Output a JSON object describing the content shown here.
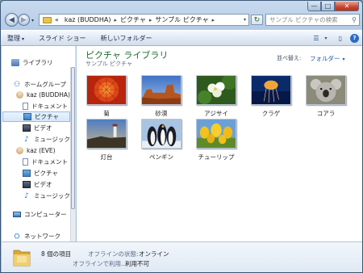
{
  "window": {
    "min_icon": "minimize-icon",
    "max_icon": "maximize-icon",
    "close_icon": "close-icon",
    "min_glyph": "—",
    "max_glyph": "□",
    "close_glyph": "✕"
  },
  "nav": {
    "back_glyph": "◀",
    "forward_glyph": "▶",
    "history_glyph": "▾",
    "address": {
      "overflow": "«",
      "crumbs": [
        "kaz (BUDDHA)",
        "ピクチャ",
        "サンプル ピクチャ"
      ],
      "separator": "▸",
      "dropdown": "▾"
    },
    "refresh_glyph": "↻",
    "search_placeholder": "サンプル ピクチャの検索",
    "search_glyph": "⚲"
  },
  "toolbar": {
    "organize": "整理",
    "slideshow": "スライド ショー",
    "new_folder": "新しいフォルダー",
    "caret": "▾",
    "views_glyph": "☰",
    "preview_glyph": "▯",
    "help_glyph": "?"
  },
  "sidebar": {
    "library": "ライブラリ",
    "homegroup": "ホームグループ",
    "user1": "kaz (BUDDHA)",
    "user1_items": [
      "ドキュメント",
      "ピクチャ",
      "ビデオ",
      "ミュージック"
    ],
    "user2": "kaz (EVE)",
    "user2_items": [
      "ドキュメント",
      "ピクチャ",
      "ビデオ",
      "ミュージック"
    ],
    "computer": "コンピューター",
    "network": "ネットワーク",
    "music_glyph": "♪",
    "group_glyph": "⚇",
    "network_glyph": "⛭"
  },
  "main": {
    "title": "ピクチャ ライブラリ",
    "subtitle": "サンプル ピクチャ",
    "sort_label": "並べ替え:",
    "sort_value": "フォルダー",
    "sort_caret": "▾",
    "items": [
      {
        "name": "菊",
        "icon": "chrysanthemum-image"
      },
      {
        "name": "砂漠",
        "icon": "desert-image"
      },
      {
        "name": "アジサイ",
        "icon": "hydrangea-image"
      },
      {
        "name": "クラゲ",
        "icon": "jellyfish-image"
      },
      {
        "name": "コアラ",
        "icon": "koala-image"
      },
      {
        "name": "灯台",
        "icon": "lighthouse-image"
      },
      {
        "name": "ペンギン",
        "icon": "penguins-image"
      },
      {
        "name": "チューリップ",
        "icon": "tulips-image"
      }
    ]
  },
  "status": {
    "count": "8 個の項目",
    "offline_label": "オフラインの状態:",
    "offline_value": "オンライン",
    "usage_label": "オフラインで利用...",
    "usage_value": "利用不可"
  }
}
